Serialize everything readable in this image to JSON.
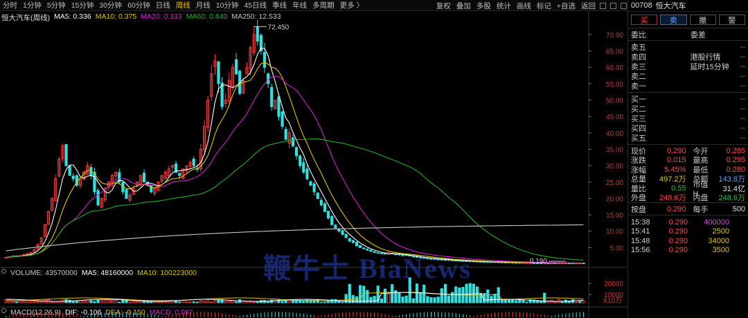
{
  "timeframes": [
    "分时",
    "1分钟",
    "5分钟",
    "15分钟",
    "30分钟",
    "60分钟",
    "日线",
    "周线",
    "月线",
    "10分钟",
    "45日线",
    "季线",
    "年线",
    "多周期",
    "更多 〉"
  ],
  "active_timeframe_index": 7,
  "tools": [
    "复权",
    "叠加",
    "多股",
    "统计",
    "画线",
    "标记",
    "+自选",
    "返回"
  ],
  "main_legend": {
    "name": "恒大汽车(周线)",
    "ma5": "MA5: 0.336",
    "ma10": "MA10: 0.375",
    "ma20": "MA20: 0.333",
    "ma60": "MA60: 0.840",
    "ma250": "MA250: 12.533"
  },
  "volume_legend": {
    "vol": "VOLUME: 43570000",
    "ma5": "MA5: 48160000",
    "ma10": "MA10: 100223000"
  },
  "macd_legend": {
    "name": "MACD(12,26,9)",
    "dif": "DIF: -0.106",
    "dea": "DEA: -0.150",
    "macd": "MACD: 0.087"
  },
  "annotations": {
    "high": "72.450",
    "low": "0.190"
  },
  "watermark": "鞭牛士 BiaNews",
  "colors": {
    "up": "#ff3b3b",
    "down": "#33e0e0",
    "ma5": "#ffffff",
    "ma10": "#e6c400",
    "ma20": "#d020d0",
    "ma60": "#20b020",
    "ma250": "#c8c8c8"
  },
  "panel": {
    "code": "00708",
    "name": "恒大汽车",
    "buttons": {
      "buy": "买",
      "sell": "卖",
      "cancel": "撤",
      "alert": "警"
    },
    "weibi": "委比",
    "weicha": "委差",
    "sell_levels": [
      "卖五",
      "卖四",
      "卖三",
      "卖二",
      "卖一"
    ],
    "buy_levels": [
      "买一",
      "买二",
      "买三",
      "买四",
      "买五"
    ],
    "dash": "--",
    "hk_note1": "港股行情",
    "hk_note2": "延时15分钟",
    "quote": [
      {
        "k1": "现价",
        "v1": "0.290",
        "c1": "red",
        "k2": "今开",
        "v2": "0.285",
        "c2": "red"
      },
      {
        "k1": "涨跌",
        "v1": "0.015",
        "c1": "red",
        "k2": "最高",
        "v2": "0.295",
        "c2": "red"
      },
      {
        "k1": "涨幅",
        "v1": "5.45%",
        "c1": "red",
        "k2": "最低",
        "v2": "0.280",
        "c2": "red"
      },
      {
        "k1": "总量",
        "v1": "497.2万",
        "c1": "yellow",
        "k2": "总额",
        "v2": "143.8万",
        "c2": "blue"
      },
      {
        "k1": "量比",
        "v1": "0.55",
        "c1": "green",
        "k2": "市值H",
        "v2": "31.4亿",
        "c2": "white"
      },
      {
        "k1": "外盘",
        "v1": "248.6万",
        "c1": "red",
        "k2": "内盘",
        "v2": "248.6万",
        "c2": "green"
      }
    ],
    "anpan": {
      "k1": "按盘",
      "v1": "0.290",
      "k2": "每手",
      "v2": "500"
    },
    "ticks": [
      {
        "t": "15:38",
        "p": "0.290",
        "v": "400000",
        "c": "magenta"
      },
      {
        "t": "15:41",
        "p": "0.290",
        "v": "2500",
        "c": "yellow"
      },
      {
        "t": "15:48",
        "p": "0.290",
        "v": "34000",
        "c": "yellow"
      },
      {
        "t": "15:56",
        "p": "0.290",
        "v": "3500",
        "c": "yellow"
      }
    ]
  },
  "axes": {
    "price_ticks": [
      "70.00",
      "65.00",
      "60.00",
      "55.00",
      "50.00",
      "45.00",
      "40.00",
      "35.00",
      "30.00",
      "25.00",
      "20.00",
      "15.00",
      "10.00",
      "5.00"
    ],
    "vol_ticks": [
      "20000",
      "10000"
    ],
    "vol_unit": "X10万"
  },
  "chart_data": {
    "type": "candlestick",
    "ylim": [
      0,
      74
    ],
    "weekly_close": [
      2.0,
      2.2,
      2.5,
      2.4,
      2.6,
      2.9,
      3.2,
      3.5,
      4.5,
      6,
      8,
      12,
      16,
      20,
      26,
      32,
      36,
      30,
      27,
      26,
      24,
      26,
      28,
      30,
      27,
      22,
      18,
      20,
      23,
      25,
      27,
      28,
      25,
      22,
      20,
      21,
      23,
      25,
      27,
      25,
      24,
      22,
      23,
      25,
      27,
      28,
      29,
      30,
      28,
      27,
      29,
      30,
      31,
      30,
      29,
      35,
      42,
      50,
      58,
      62,
      55,
      48,
      50,
      56,
      60,
      58,
      52,
      56,
      60,
      66,
      70,
      68,
      65,
      60,
      55,
      48,
      50,
      45,
      42,
      38,
      40,
      36,
      33,
      30,
      28,
      26,
      24,
      22,
      20,
      18,
      16,
      14,
      12,
      11,
      10,
      9,
      8,
      7,
      6.5,
      5.5,
      5,
      4.6,
      4.2,
      3.8,
      3.5,
      3.3,
      3.2,
      3.0,
      3.4,
      3.1,
      2.9,
      2.8,
      2.7,
      2.6,
      2.4,
      2.2,
      2.0,
      1.9,
      1.8,
      1.7,
      1.6,
      1.5,
      1.4,
      1.35,
      1.3,
      1.2,
      1.1,
      1.05,
      1.0,
      0.95,
      0.9,
      0.85,
      0.8,
      0.75,
      0.7,
      0.68,
      0.65,
      0.6,
      0.58,
      0.55,
      0.52,
      0.5,
      0.48,
      0.46,
      0.44,
      0.42,
      0.4,
      0.38,
      0.36,
      0.34,
      0.32,
      0.3,
      0.29,
      0.29,
      0.29,
      0.3,
      0.32,
      0.31,
      0.3,
      0.29,
      0.28,
      0.3,
      0.29,
      0.29
    ]
  }
}
